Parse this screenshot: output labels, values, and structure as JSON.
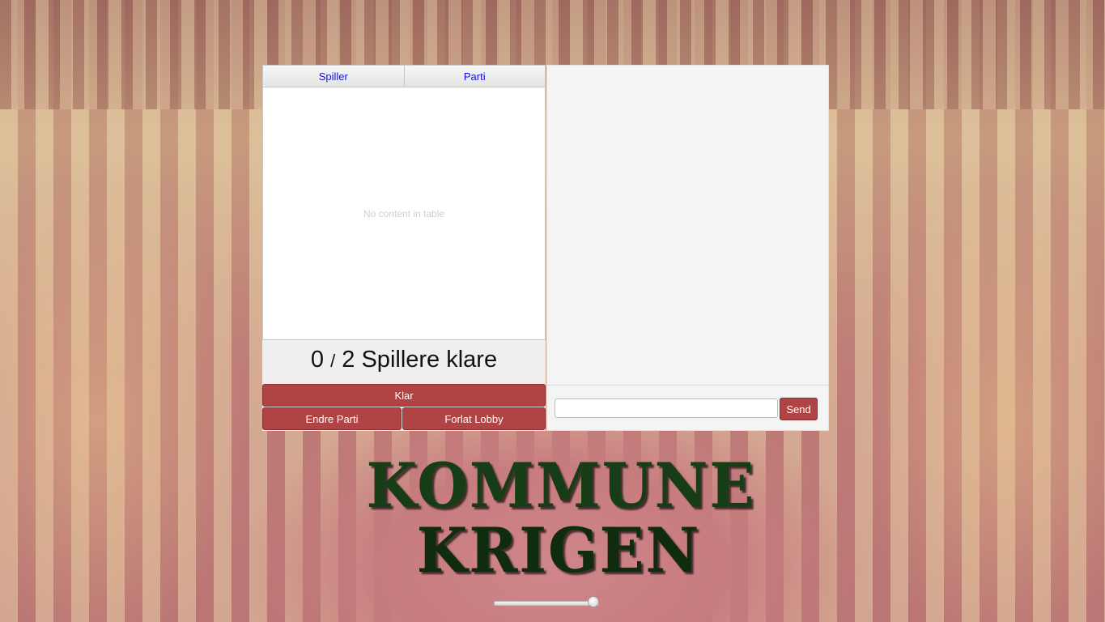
{
  "player_table": {
    "columns": [
      "Spiller",
      "Parti"
    ],
    "placeholder": "No content in table"
  },
  "ready_status": {
    "ready": "0",
    "separator": "/",
    "total": "2",
    "label": "Spillere klare"
  },
  "buttons": {
    "ready": "Klar",
    "change_party": "Endre Parti",
    "leave_lobby": "Forlat Lobby",
    "send": "Send"
  },
  "chat": {
    "input_value": ""
  },
  "logo": {
    "line1": "KOMMUNE",
    "line2": "KRIGEN"
  },
  "volume_slider": {
    "level": 1.0
  },
  "colors": {
    "button": "#b04343",
    "header_text": "#1212d6",
    "logo": "#173d17"
  }
}
